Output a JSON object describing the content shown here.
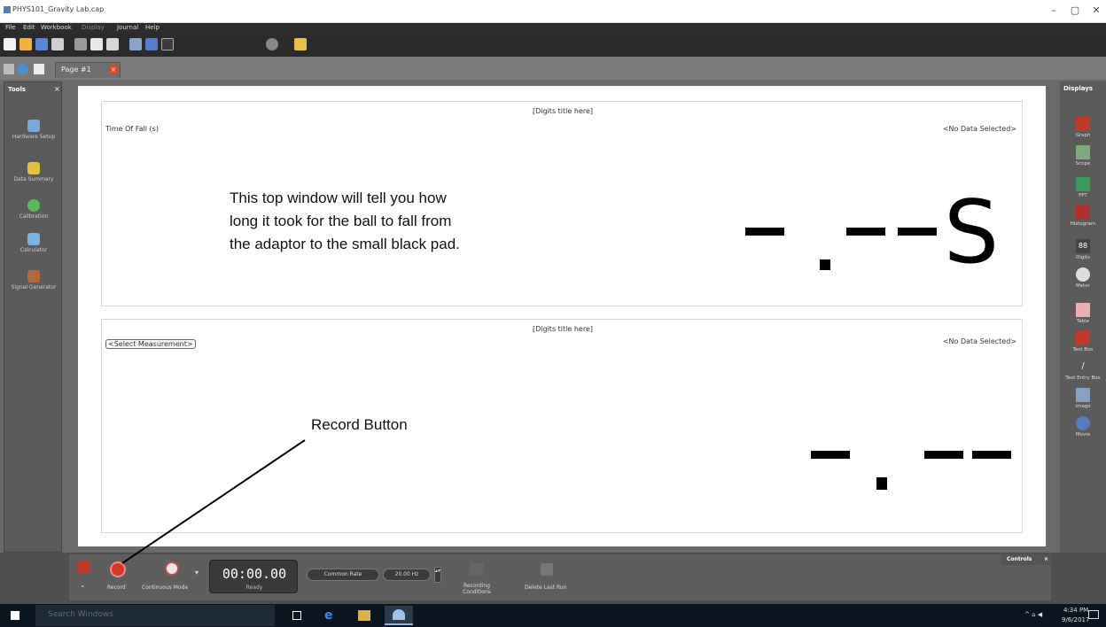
{
  "window": {
    "title": "PHYS101_Gravity Lab.cap",
    "controls": [
      "–",
      "▢",
      "✕"
    ]
  },
  "menu": [
    "File",
    "Edit",
    "Workbook",
    "Display",
    "Journal",
    "Help"
  ],
  "tab": {
    "label": "Page #1"
  },
  "tools_panel": {
    "header": "Tools",
    "close": "×",
    "items": [
      "Hardware Setup",
      "Data Summary",
      "Calibration",
      "Calculator",
      "Signal Generator"
    ]
  },
  "displays_panel": {
    "header": "Displays",
    "items": [
      "Graph",
      "Scope",
      "FFT",
      "Histogram",
      "Digits",
      "Meter",
      "Table",
      "Text Box",
      "Text Entry Box",
      "Image",
      "Movie"
    ]
  },
  "display_top": {
    "title": "[Digits title here]",
    "measurement": "Time Of Fall (s)",
    "no_data": "<No Data Selected>",
    "annotation": [
      "This top window will tell you how",
      "long it took for the ball to fall from",
      "the adaptor to the small black pad."
    ],
    "unit": "S"
  },
  "display_bottom": {
    "title": "[Digits title here]",
    "measurement": "<Select Measurement>",
    "no_data": "<No Data Selected>",
    "annotation": "Record Button"
  },
  "controls": {
    "header": "Controls",
    "close": "×",
    "record_label": "Record",
    "mode_label": "Continuous Mode",
    "time": "00:00.00",
    "time_label": "Ready",
    "rate_mode": "Common Rate",
    "rate_value": "20.00 Hz",
    "recording_conditions": "Recording Conditions",
    "delete_last_run": "Delete Last Run"
  },
  "taskbar": {
    "search_placeholder": "Search Windows",
    "time": "4:34 PM",
    "date": "9/6/2017"
  },
  "colors": {
    "record_red": "#d9342a",
    "tab_close": "#d94a2a",
    "panel_dark": "#5b5b5b"
  }
}
